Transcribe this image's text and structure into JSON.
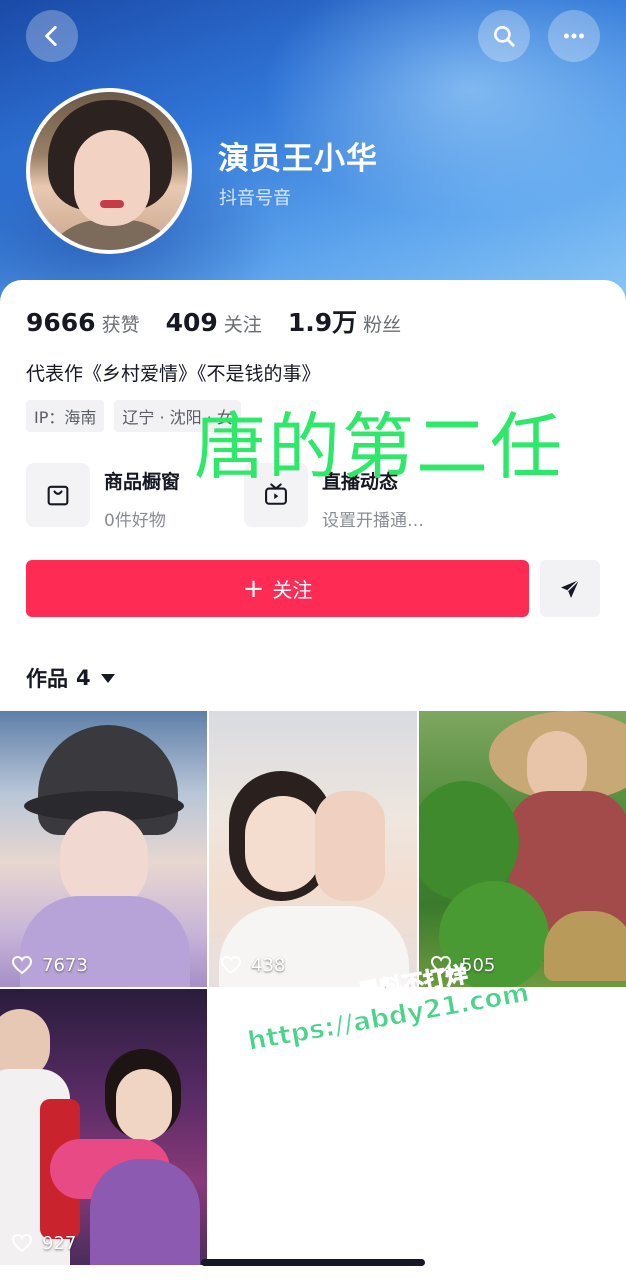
{
  "profile": {
    "name": "演员王小华",
    "handle": "抖音号音"
  },
  "stats": [
    {
      "value": "9666",
      "label": "获赞"
    },
    {
      "value": "409",
      "label": "关注"
    },
    {
      "value": "1.9万",
      "label": "粉丝"
    }
  ],
  "bio": "代表作《乡村爱情》《不是钱的事》",
  "tags": [
    "IP：海南",
    "辽宁 · 沈阳 · 女"
  ],
  "shortcuts": [
    {
      "title": "商品橱窗",
      "subtitle": "0件好物"
    },
    {
      "title": "直播动态",
      "subtitle": "设置开播通…"
    }
  ],
  "actions": {
    "follow_label": "关注"
  },
  "works": {
    "label": "作品",
    "count": "4"
  },
  "videos": [
    {
      "likes": "7673"
    },
    {
      "likes": "438"
    },
    {
      "likes": "505"
    },
    {
      "likes": "927"
    }
  ],
  "overlay": {
    "green_caption": "唐的第二任",
    "site_line1": "黑料不打烊",
    "site_line2": "https://abdy21.com"
  },
  "colors": {
    "accent": "#fe2c55",
    "header_blue": "#2f74d6",
    "caption_green": "#2ee86a"
  }
}
